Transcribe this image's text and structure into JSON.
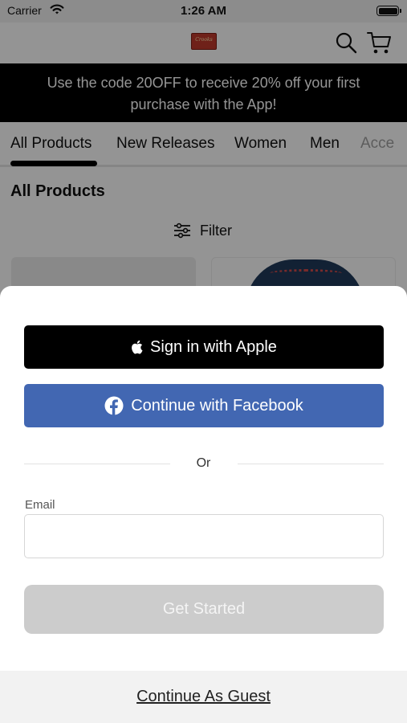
{
  "status_bar": {
    "carrier": "Carrier",
    "time": "1:26 AM"
  },
  "header": {
    "logo_text": "Crooks",
    "icons": [
      "search-icon",
      "cart-icon"
    ]
  },
  "promo": {
    "text": "Use the code 20OFF to receive 20% off your first purchase with the App!"
  },
  "tabs": [
    {
      "label": "All Products",
      "selected": true
    },
    {
      "label": "New Releases"
    },
    {
      "label": "Women"
    },
    {
      "label": "Men"
    },
    {
      "label": "Acce"
    }
  ],
  "main": {
    "title": "All Products",
    "filter_label": "Filter"
  },
  "sheet": {
    "apple_label": "Sign in with Apple",
    "facebook_label": "Continue with Facebook",
    "divider_text": "Or",
    "email_label": "Email",
    "email_value": "",
    "get_started_label": "Get Started",
    "guest_label": "Continue As Guest"
  },
  "colors": {
    "promo_bg": "#000000",
    "facebook_blue": "#4267B2",
    "apple_black": "#000000",
    "disabled_button": "#CCCCCC",
    "overlay": "rgba(0,0,0,0.42)"
  }
}
